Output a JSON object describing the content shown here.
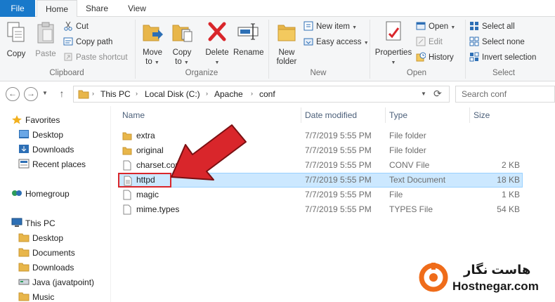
{
  "tabs": {
    "file": "File",
    "home": "Home",
    "share": "Share",
    "view": "View"
  },
  "ribbon": {
    "clipboard": {
      "copy": "Copy",
      "paste": "Paste",
      "cut": "Cut",
      "copy_path": "Copy path",
      "paste_shortcut": "Paste shortcut",
      "label": "Clipboard"
    },
    "organize": {
      "move_to_1": "Move",
      "move_to_2": "to",
      "copy_to_1": "Copy",
      "copy_to_2": "to",
      "delete": "Delete",
      "rename": "Rename",
      "label": "Organize"
    },
    "new": {
      "new_folder_1": "New",
      "new_folder_2": "folder",
      "new_item": "New item",
      "easy_access": "Easy access",
      "label": "New"
    },
    "open": {
      "properties": "Properties",
      "open": "Open",
      "edit": "Edit",
      "history": "History",
      "label": "Open"
    },
    "select": {
      "select_all": "Select all",
      "select_none": "Select none",
      "invert_selection": "Invert selection",
      "label": "Select"
    }
  },
  "address": {
    "crumbs": [
      "This PC",
      "Local Disk (C:)",
      "Apache",
      "conf"
    ],
    "search_placeholder": "Search conf"
  },
  "sidebar": {
    "favorites": "Favorites",
    "fav_items": [
      "Desktop",
      "Downloads",
      "Recent places"
    ],
    "homegroup": "Homegroup",
    "this_pc": "This PC",
    "pc_items": [
      "Desktop",
      "Documents",
      "Downloads",
      "Java (javatpoint)",
      "Music"
    ]
  },
  "columns": {
    "name": "Name",
    "date": "Date modified",
    "type": "Type",
    "size": "Size"
  },
  "files": [
    {
      "name": "extra",
      "date": "7/7/2019 5:55 PM",
      "type": "File folder",
      "size": "",
      "kind": "folder"
    },
    {
      "name": "original",
      "date": "7/7/2019 5:55 PM",
      "type": "File folder",
      "size": "",
      "kind": "folder"
    },
    {
      "name": "charset.conv",
      "date": "7/7/2019 5:55 PM",
      "type": "CONV File",
      "size": "2 KB",
      "kind": "file"
    },
    {
      "name": "httpd",
      "date": "7/7/2019 5:55 PM",
      "type": "Text Document",
      "size": "18 KB",
      "kind": "text"
    },
    {
      "name": "magic",
      "date": "7/7/2019 5:55 PM",
      "type": "File",
      "size": "1 KB",
      "kind": "file"
    },
    {
      "name": "mime.types",
      "date": "7/7/2019 5:55 PM",
      "type": "TYPES File",
      "size": "54 KB",
      "kind": "file"
    }
  ],
  "selected_file": "httpd",
  "watermark": {
    "persian": "هاست نگار",
    "latin": "Hostnegar.com"
  },
  "colors": {
    "accent": "#1979ca",
    "selection": "#cce8ff",
    "arrow": "#d9262b",
    "folder": "#e8b64a",
    "logo": "#ef6c1a"
  }
}
